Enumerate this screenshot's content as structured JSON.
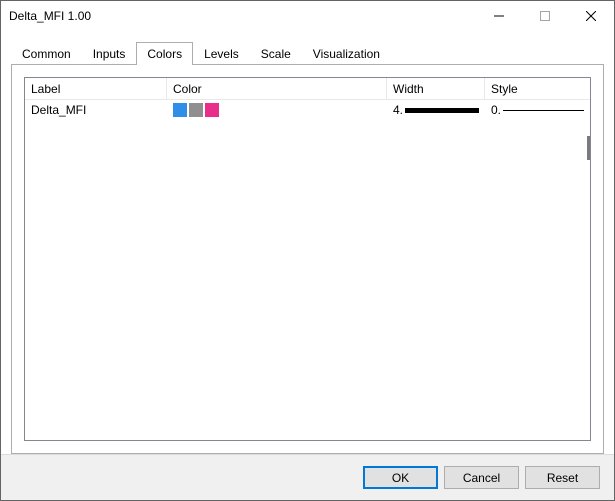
{
  "window": {
    "title": "Delta_MFI 1.00"
  },
  "tabs": {
    "items": [
      {
        "label": "Common",
        "active": false
      },
      {
        "label": "Inputs",
        "active": false
      },
      {
        "label": "Colors",
        "active": true
      },
      {
        "label": "Levels",
        "active": false
      },
      {
        "label": "Scale",
        "active": false
      },
      {
        "label": "Visualization",
        "active": false
      }
    ]
  },
  "listview": {
    "headers": {
      "label": "Label",
      "color": "Color",
      "width": "Width",
      "style": "Style"
    },
    "rows": [
      {
        "label": "Delta_MFI",
        "colors": [
          "#2f8fe8",
          "#8f8f8f",
          "#e82d8a"
        ],
        "width_value": "4.",
        "style_value": "0."
      }
    ]
  },
  "buttons": {
    "ok": "OK",
    "cancel": "Cancel",
    "reset": "Reset"
  }
}
